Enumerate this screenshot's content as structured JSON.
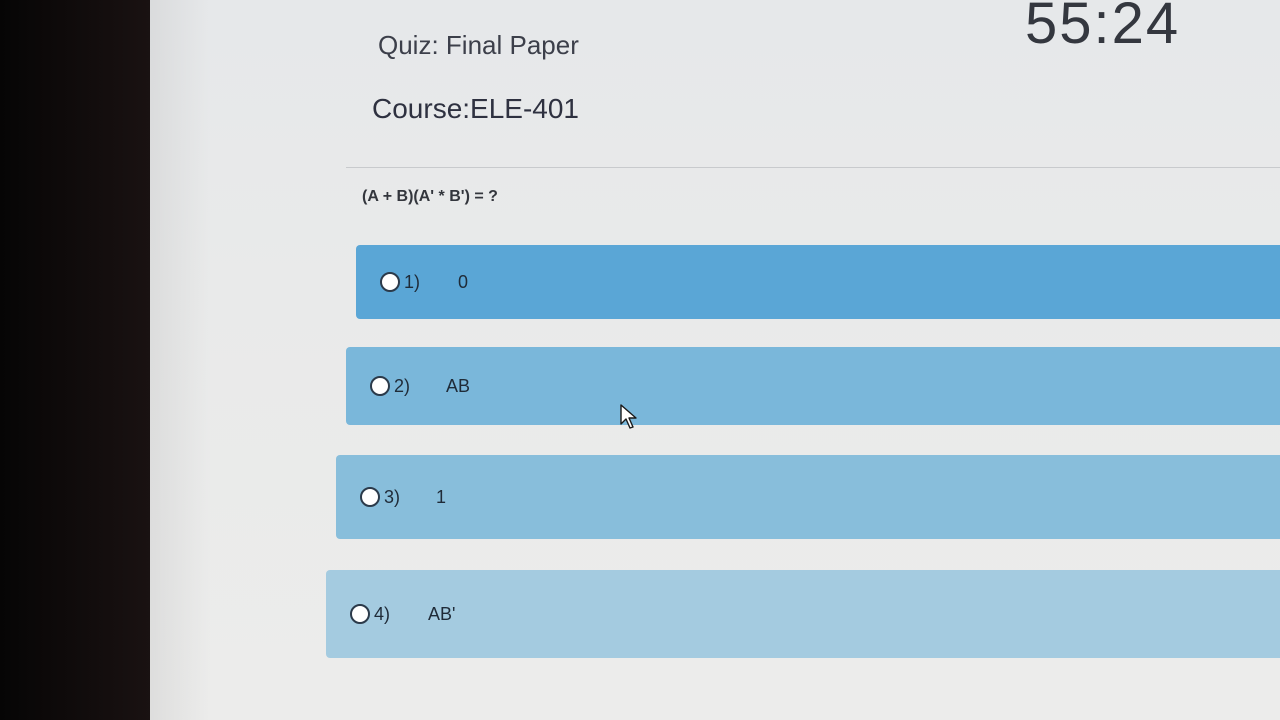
{
  "timer": "55:24",
  "quiz": {
    "title": "Quiz: Final Paper",
    "course": "Course:ELE-401"
  },
  "question": {
    "text": "(A + B)(A' * B') = ?"
  },
  "options": [
    {
      "number": "1)",
      "value": "0",
      "color": "#5aa6d6"
    },
    {
      "number": "2)",
      "value": "AB",
      "color": "#7ab7da"
    },
    {
      "number": "3)",
      "value": "1",
      "color": "#88bedb"
    },
    {
      "number": "4)",
      "value": "AB'",
      "color": "#a4cbe0"
    }
  ],
  "icons": {
    "radio": "radio-empty-icon",
    "cursor": "mouse-pointer-icon"
  }
}
